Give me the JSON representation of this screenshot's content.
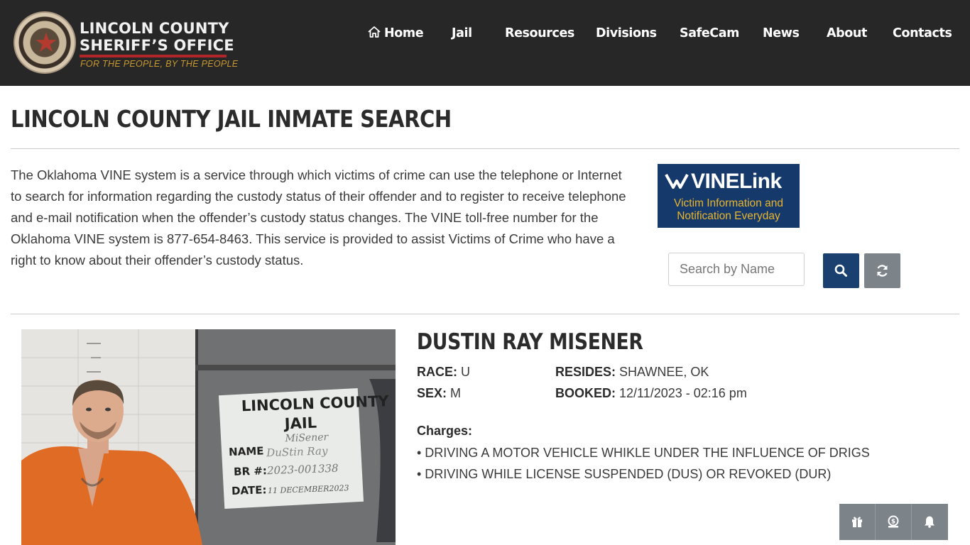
{
  "header": {
    "logo_line1": "LINCOLN COUNTY",
    "logo_line2": "SHERIFF’S OFFICE",
    "tagline": "FOR THE PEOPLE, BY THE PEOPLE",
    "nav": [
      {
        "label": "Home",
        "icon": "home-icon"
      },
      {
        "label": "Jail"
      },
      {
        "label": "Resources"
      },
      {
        "label": "Divisions"
      },
      {
        "label": "SafeCam"
      },
      {
        "label": "News"
      },
      {
        "label": "About"
      },
      {
        "label": "Contacts"
      }
    ]
  },
  "page": {
    "title": "LINCOLN COUNTY JAIL INMATE SEARCH",
    "intro": "The Oklahoma VINE system is a service through which victims of crime can use the telephone or Internet to search for information regarding the custody status of their offender and to register to receive telephone and e-mail notification when the offender’s custody status changes. The VINE toll-free number for the Oklahoma VINE system is 877-654-8463. This service is provided to assist Victims of Crime who have a right to know about their offender’s custody status."
  },
  "vine": {
    "title": "VINELink",
    "subtitle_line1": "Victim Information and",
    "subtitle_line2": "Notification Everyday"
  },
  "search": {
    "placeholder": "Search by Name",
    "search_icon": "search-icon",
    "refresh_icon": "refresh-icon"
  },
  "inmate": {
    "name": "DUSTIN RAY MISENER",
    "race_label": "RACE:",
    "race": "U",
    "sex_label": "SEX:",
    "sex": "M",
    "resides_label": "RESIDES:",
    "resides": "SHAWNEE, OK",
    "booked_label": "BOOKED:",
    "booked": "12/11/2023 - 02:16 pm",
    "charges_label": "Charges:",
    "charges": [
      "• DRIVING A MOTOR VEHICLE WHIKLE UNDER THE INFLUENCE OF DRIGS",
      "• DRIVING WHILE LICENSE SUSPENDED (DUS) OR REVOKED (DUR)"
    ],
    "photo_board": {
      "line1": "LINCOLN COUNTY",
      "line2": "JAIL",
      "name_label": "NAME",
      "name_value1": "MiSener",
      "name_value2": "DuStin Ray",
      "br_label": "BR #:",
      "br_value": "2023-001338",
      "date_label": "DATE:",
      "date_value": "11 DECEMBER2023"
    }
  },
  "floating": [
    "gift-icon",
    "money-icon",
    "bell-icon"
  ],
  "colors": {
    "header_bg": "#272727",
    "brand_red": "#b0262a",
    "tagline_gold": "#c8992f",
    "search_button": "#19406f",
    "gray_button": "#7c8389",
    "vine_bg": "#16396b",
    "vine_gold": "#e8b52e"
  }
}
